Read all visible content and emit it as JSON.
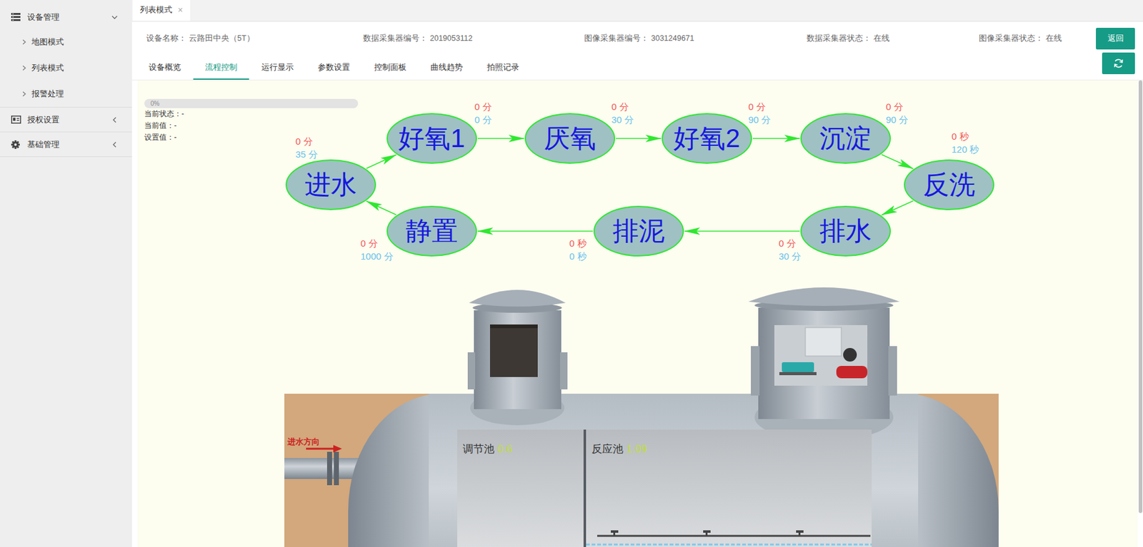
{
  "sidebar": {
    "items": [
      {
        "label": "设备管理",
        "expanded": true,
        "children": [
          {
            "label": "地图模式",
            "selected": false
          },
          {
            "label": "列表模式",
            "selected": false
          },
          {
            "label": "报警处理",
            "selected": false
          }
        ]
      },
      {
        "label": "授权设置",
        "expanded": false,
        "children": []
      },
      {
        "label": "基础管理",
        "expanded": false,
        "children": []
      }
    ]
  },
  "tabs": [
    {
      "label": "列表模式",
      "close": "×",
      "selected": true
    }
  ],
  "device_info": [
    {
      "label": "设备名称：",
      "value": "云路田中央（5T）"
    },
    {
      "label": "数据采集器编号：",
      "value": "2019053112"
    },
    {
      "label": "图像采集器编号：",
      "value": "3031249671"
    },
    {
      "label": "数据采集器状态：",
      "value": "在线"
    },
    {
      "label": "图像采集器状态：",
      "value": "在线"
    }
  ],
  "buttons": {
    "back": "返回"
  },
  "sub_tabs": [
    {
      "label": "设备概览",
      "selected": false
    },
    {
      "label": "流程控制",
      "selected": true
    },
    {
      "label": "运行显示",
      "selected": false
    },
    {
      "label": "参数设置",
      "selected": false
    },
    {
      "label": "控制面板",
      "selected": false
    },
    {
      "label": "曲线趋势",
      "selected": false
    },
    {
      "label": "拍照记录",
      "selected": false
    }
  ],
  "progress": {
    "level": 0,
    "reading": "0%"
  },
  "status": [
    {
      "label": "当前状态：",
      "value": "-"
    },
    {
      "label": "当前值：",
      "value": "-"
    },
    {
      "label": "设置值：",
      "value": "-"
    }
  ],
  "process": {
    "steps": [
      {
        "label": "进水",
        "elapsed": "0 分",
        "setting": "35 分"
      },
      {
        "label": "好氧1",
        "elapsed": "0 分",
        "setting": "0 分"
      },
      {
        "label": "厌氧",
        "elapsed": "0 分",
        "setting": "30 分"
      },
      {
        "label": "好氧2",
        "elapsed": "0 分",
        "setting": "90 分"
      },
      {
        "label": "沉淀",
        "elapsed": "0 分",
        "setting": "90 分"
      },
      {
        "label": "反洗",
        "elapsed": "0 秒",
        "setting": "120 秒"
      },
      {
        "label": "排水",
        "elapsed": "0 分",
        "setting": "30 分"
      },
      {
        "label": "排泥",
        "elapsed": "0 秒",
        "setting": "0 秒"
      },
      {
        "label": "静置",
        "elapsed": "0 分",
        "setting": "1000 分"
      }
    ]
  },
  "tank": {
    "inlet_label": "进水方向",
    "chambers": [
      {
        "name": "调节池",
        "reading": "0.6"
      },
      {
        "name": "反应池",
        "reading": "1.09"
      }
    ]
  }
}
